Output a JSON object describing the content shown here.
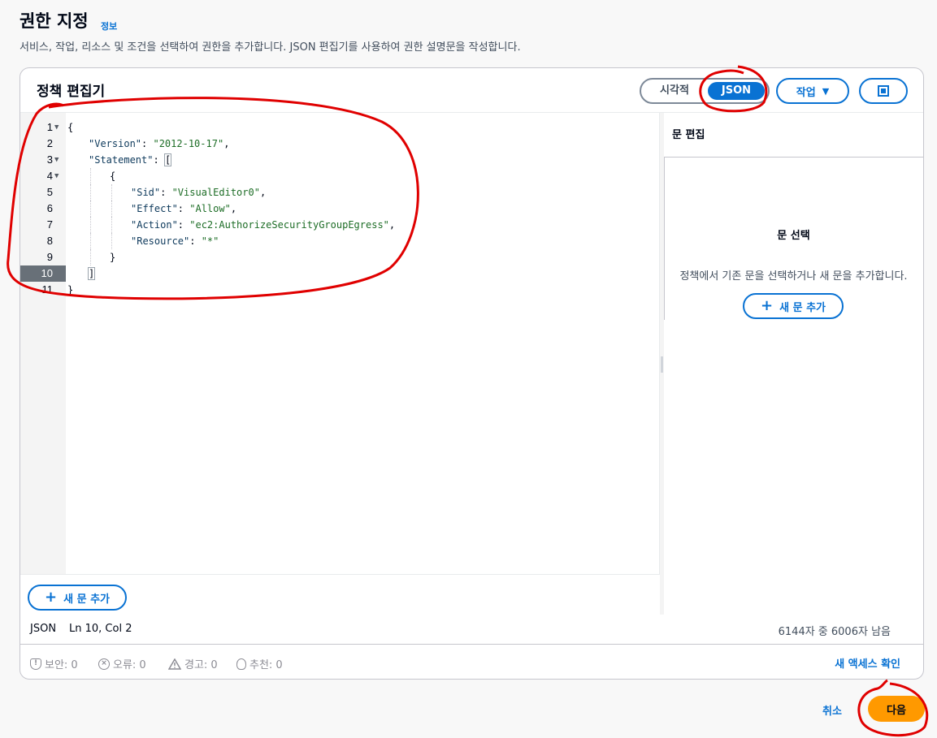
{
  "header": {
    "title": "권한 지정",
    "info": "정보",
    "description": "서비스, 작업, 리소스 및 조건을 선택하여 권한을 추가합니다. JSON 편집기를 사용하여 권한 설명문을 작성합니다."
  },
  "editor": {
    "title": "정책 편집기",
    "mode_visual": "시각적",
    "mode_json": "JSON",
    "active_mode": "JSON",
    "actions_label": "작업",
    "add_statement_label": "새 문 추가",
    "active_line": "10",
    "lines": [
      {
        "num": "1",
        "text": "{"
      },
      {
        "num": "2",
        "key": "\"Version\"",
        "value": "\"2012-10-17\""
      },
      {
        "num": "3",
        "key": "\"Statement\"",
        "open": "["
      },
      {
        "num": "4",
        "text": "{"
      },
      {
        "num": "5",
        "key": "\"Sid\"",
        "value": "\"VisualEditor0\""
      },
      {
        "num": "6",
        "key": "\"Effect\"",
        "value": "\"Allow\""
      },
      {
        "num": "7",
        "key": "\"Action\"",
        "value": "\"ec2:AuthorizeSecurityGroupEgress\""
      },
      {
        "num": "8",
        "key": "\"Resource\"",
        "value": "\"*\""
      },
      {
        "num": "9",
        "text": "}"
      },
      {
        "num": "10",
        "text": "]"
      },
      {
        "num": "11",
        "text": "}"
      }
    ]
  },
  "side_panel": {
    "header": "문 편집",
    "empty_title": "문 선택",
    "empty_desc": "정책에서 기존 문을 선택하거나 새 문을 추가합니다.",
    "add_label": "새 문 추가"
  },
  "status": {
    "language": "JSON",
    "position": "Ln 10, Col 2",
    "chars": "6144자 중 6006자 남음"
  },
  "validation": {
    "security": "보안: 0",
    "errors": "오류: 0",
    "warnings": "경고: 0",
    "suggestions": "추천: 0",
    "review_link": "새 액세스 확인"
  },
  "footer": {
    "cancel": "취소",
    "next": "다음"
  },
  "colors": {
    "accent": "#0972d3",
    "primary_button": "#ff9900",
    "annotation": "#e00000"
  }
}
